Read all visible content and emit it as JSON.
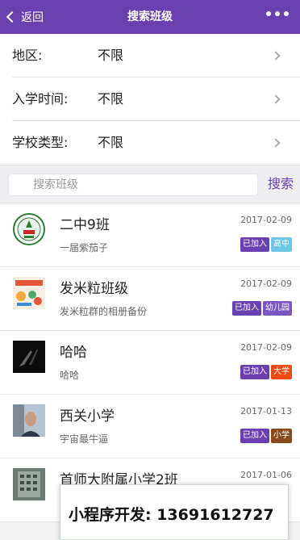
{
  "header": {
    "back_label": "返回",
    "title": "搜索班级"
  },
  "filters": [
    {
      "label": "地区:",
      "value": "不限"
    },
    {
      "label": "入学时间:",
      "value": "不限"
    },
    {
      "label": "学校类型:",
      "value": "不限"
    }
  ],
  "search": {
    "placeholder": "搜索班级",
    "button_label": "搜索"
  },
  "classes": [
    {
      "name": "二中9班",
      "desc": "一届紫茄子",
      "date": "2017-02-09",
      "tags": [
        {
          "text": "已加入",
          "color": "#6a3fb0"
        },
        {
          "text": "高中",
          "color": "#6ac7e8"
        }
      ],
      "thumb": "school-emblem"
    },
    {
      "name": "发米粒班级",
      "desc": "发米粒群的相册备份",
      "date": "2017-02-09",
      "tags": [
        {
          "text": "已加入",
          "color": "#6a3fb0"
        },
        {
          "text": "幼儿园",
          "color": "#7b55c2"
        }
      ],
      "thumb": "kids-drawing"
    },
    {
      "name": "哈哈",
      "desc": "哈哈",
      "date": "2017-02-09",
      "tags": [
        {
          "text": "已加入",
          "color": "#6a3fb0"
        },
        {
          "text": "大学",
          "color": "#ef4a12"
        }
      ],
      "thumb": "dark-photo"
    },
    {
      "name": "西关小学",
      "desc": "宇宙最牛逼",
      "date": "2017-01-13",
      "tags": [
        {
          "text": "已加入",
          "color": "#6a3fb0"
        },
        {
          "text": "小学",
          "color": "#8a4a1a"
        }
      ],
      "thumb": "person-photo"
    },
    {
      "name": "首师大附属小学2班",
      "desc": "",
      "date": "2017-01-06",
      "tags": [],
      "thumb": "building-photo"
    }
  ],
  "popup": {
    "text": "小程序开发: 13691612727"
  }
}
